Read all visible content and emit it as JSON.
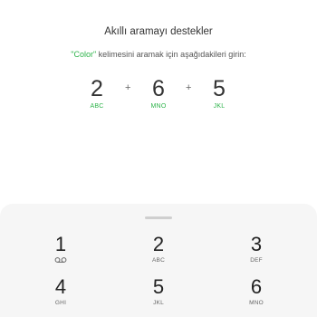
{
  "title": "Akıllı aramayı destekler",
  "hint": {
    "accent_word": "\"Color\"",
    "rest": " kelimesini aramak için aşağıdakileri girin:"
  },
  "sequence": [
    {
      "digit": "2",
      "letters": "ABC"
    },
    {
      "digit": "6",
      "letters": "MNO"
    },
    {
      "digit": "5",
      "letters": "JKL"
    }
  ],
  "plus_sign": "+",
  "keypad": {
    "k1": {
      "digit": "1",
      "icon": "voicemail-icon"
    },
    "k2": {
      "digit": "2",
      "letters": "ABC"
    },
    "k3": {
      "digit": "3",
      "letters": "DEF"
    },
    "k4": {
      "digit": "4",
      "letters": "GHI"
    },
    "k5": {
      "digit": "5",
      "letters": "JKL"
    },
    "k6": {
      "digit": "6",
      "letters": "MNO"
    }
  },
  "colors": {
    "accent": "#2db34a",
    "dialer_bg": "#f6f6f6"
  }
}
